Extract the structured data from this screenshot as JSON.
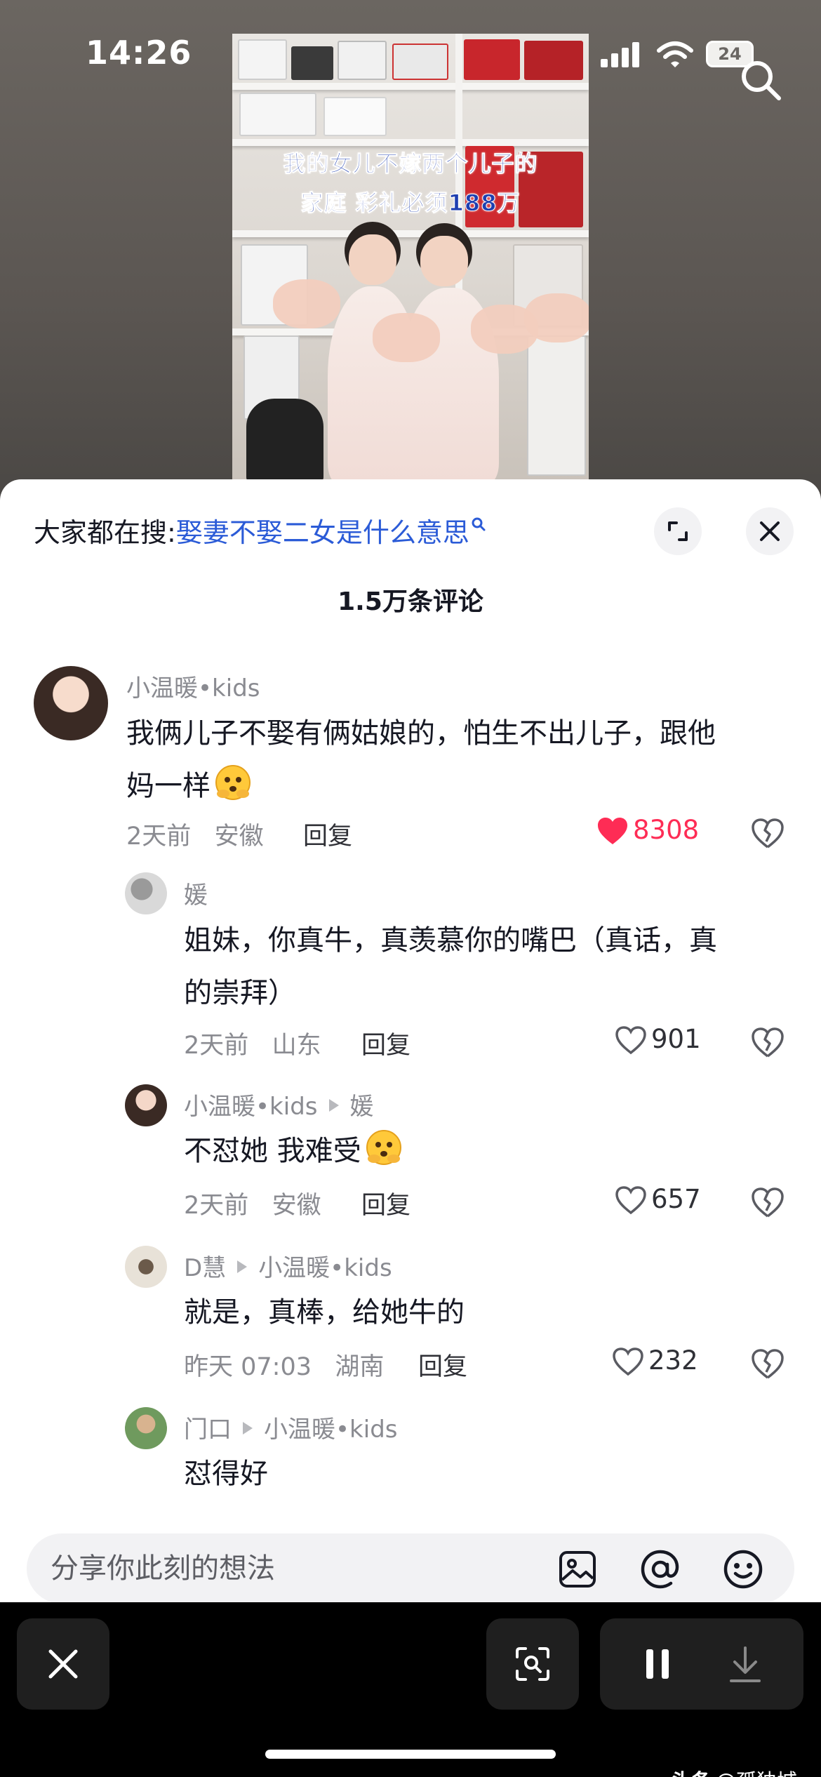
{
  "status_bar": {
    "time": "14:26",
    "battery": "24"
  },
  "video": {
    "caption_line1": "我的女儿不嫁两个儿子的",
    "caption_line2": "家庭 彩礼必须188万"
  },
  "hot_search": {
    "prefix": "大家都在搜:",
    "query": "娶妻不娶二女是什么意思"
  },
  "comments_header": {
    "count_label": "1.5万条评论"
  },
  "comments": [
    {
      "author": "小温暖•kids",
      "text_line1": "我俩儿子不娶有俩姑娘的，怕生不出儿子，跟他",
      "text_line2": "妈一样",
      "time": "2天前",
      "location": "安徽",
      "reply_label": "回复",
      "likes": "8308"
    },
    {
      "author": "媛",
      "text_line1": "姐妹，你真牛，真羡慕你的嘴巴（真话，真",
      "text_line2": "的崇拜）",
      "time": "2天前",
      "location": "山东",
      "reply_label": "回复",
      "likes": "901"
    },
    {
      "author": "小温暖•kids",
      "reply_to": "媛",
      "text_line1": "不怼她 我难受",
      "time": "2天前",
      "location": "安徽",
      "reply_label": "回复",
      "likes": "657"
    },
    {
      "author": "D慧",
      "reply_to": "小温暖•kids",
      "text_line1": "就是，真棒，给她牛的",
      "time": "昨天 07:03",
      "location": "湖南",
      "reply_label": "回复",
      "likes": "232"
    },
    {
      "author": "门口",
      "reply_to": "小温暖•kids",
      "text_line1": "怼得好"
    }
  ],
  "input": {
    "placeholder": "分享你此刻的想法"
  },
  "icons": {
    "status": [
      "signal-icon",
      "wifi-icon",
      "battery-icon"
    ],
    "top": [
      "search-icon"
    ],
    "sheet": [
      "expand-icon",
      "close-icon",
      "heart-icon",
      "dislike-heart-icon"
    ],
    "input": [
      "image-icon",
      "mention-icon",
      "emoji-icon"
    ],
    "toolbar": [
      "close-icon",
      "scan-icon",
      "pause-icon",
      "download-icon"
    ]
  },
  "colors": {
    "like_red": "#fe2c55",
    "link_blue": "#2b5bd7",
    "caption_blue": "#1f3fb0",
    "sheet_bg": "#ffffff"
  },
  "watermark": {
    "platform": "头条",
    "handle": "@孤独城"
  }
}
